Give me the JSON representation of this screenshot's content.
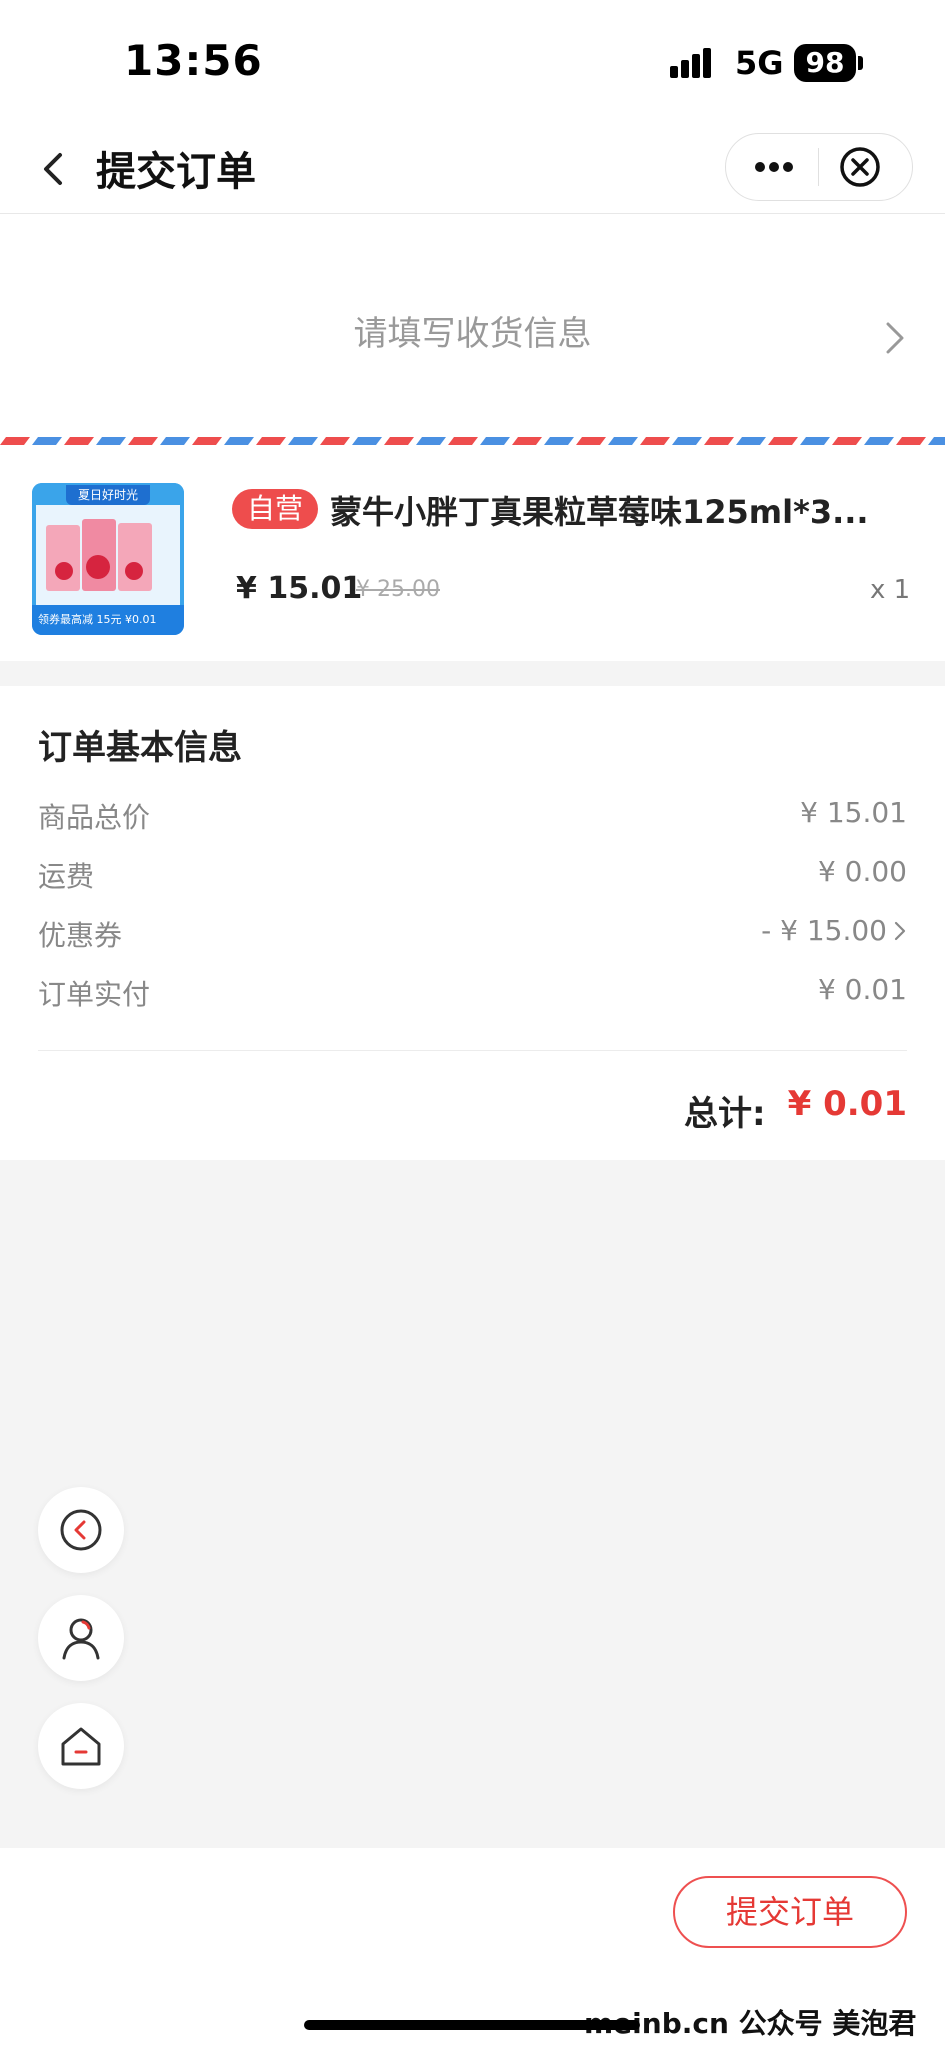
{
  "status_bar": {
    "time": "13:56",
    "network": "5G",
    "battery": "98"
  },
  "nav": {
    "title": "提交订单"
  },
  "address": {
    "placeholder_text": "请填写收货信息"
  },
  "product": {
    "tag": "自营",
    "name": "蒙牛小胖丁真果粒草莓味125ml*3...",
    "price": "¥ 15.01",
    "original_price": "¥ 25.00",
    "quantity": "x 1",
    "thumbnail_banner": "夏日好时光",
    "thumbnail_caption": "领券最高减 15元 ¥0.01"
  },
  "order_info": {
    "title": "订单基本信息",
    "rows": [
      {
        "label": "商品总价",
        "value": "¥ 15.01"
      },
      {
        "label": "运费",
        "value": "¥  0.00"
      },
      {
        "label": "优惠券",
        "value": "- ¥ 15.00"
      },
      {
        "label": "订单实付",
        "value": "¥ 0.01"
      }
    ],
    "total_label": "总计:",
    "total_value": "¥ 0.01"
  },
  "floating": {
    "icons": [
      "back-circle-icon",
      "user-icon",
      "home-icon"
    ]
  },
  "bottom": {
    "submit_label": "提交订单",
    "watermark": "meinb.cn 公众号 美泡君"
  },
  "colors": {
    "accent": "#e53935",
    "stripe_red": "#ee4d4d",
    "stripe_blue": "#4a90e2"
  }
}
